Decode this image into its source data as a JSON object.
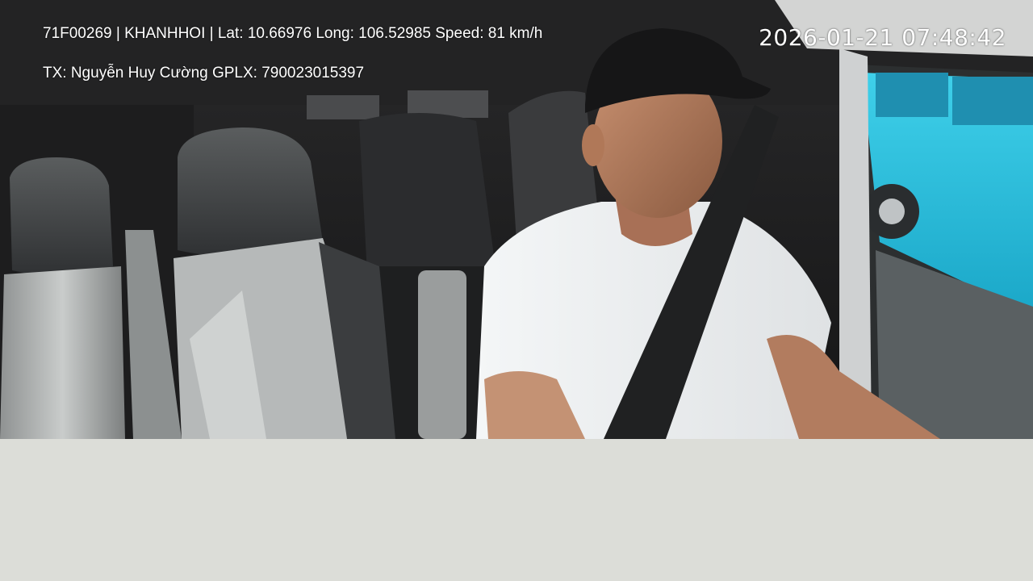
{
  "overlay": {
    "info_line": "71F00269 | KHANHHOI | Lat: 10.66976 Long: 106.52985 Speed: 81 km/h",
    "driver_line": "TX: Nguyễn Huy Cường GPLX: 790023015397",
    "timestamp": "2026-01-21 07:48:42"
  },
  "colors": {
    "background": "#dcddd8",
    "overlay_text": "#ffffff",
    "bus_outside": "#35c4e0"
  }
}
